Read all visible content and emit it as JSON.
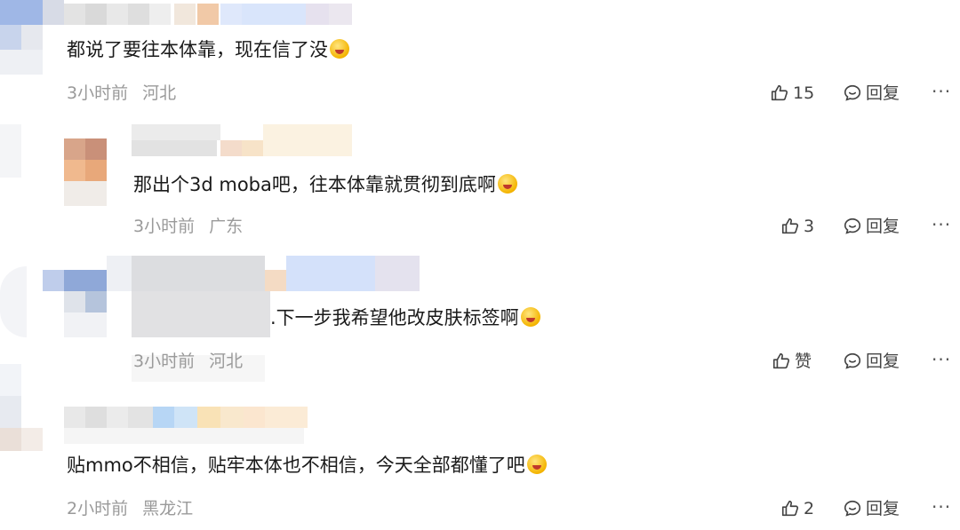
{
  "comments": [
    {
      "text": "都说了要往本体靠，现在信了没",
      "emoji": "yum-emoji",
      "time": "3小时前",
      "location": "河北",
      "like_count": "15",
      "reply_label": "回复",
      "more_label": "···"
    },
    {
      "text": "那出个3d moba吧，往本体靠就贯彻到底啊",
      "emoji": "flushed-emoji",
      "time": "3小时前",
      "location": "广东",
      "like_count": "3",
      "reply_label": "回复",
      "more_label": "···"
    },
    {
      "text": ".下一步我希望他改皮肤标签啊",
      "emoji": "yawn-emoji",
      "time": "3小时前",
      "location": "河北",
      "like_count": "赞",
      "reply_label": "回复",
      "more_label": "···"
    },
    {
      "text": "贴mmo不相信，贴牢本体也不相信，今天全部都懂了吧",
      "emoji": "smile-emoji",
      "time": "2小时前",
      "location": "黑龙江",
      "like_count": "2",
      "reply_label": "回复",
      "more_label": "···"
    }
  ]
}
